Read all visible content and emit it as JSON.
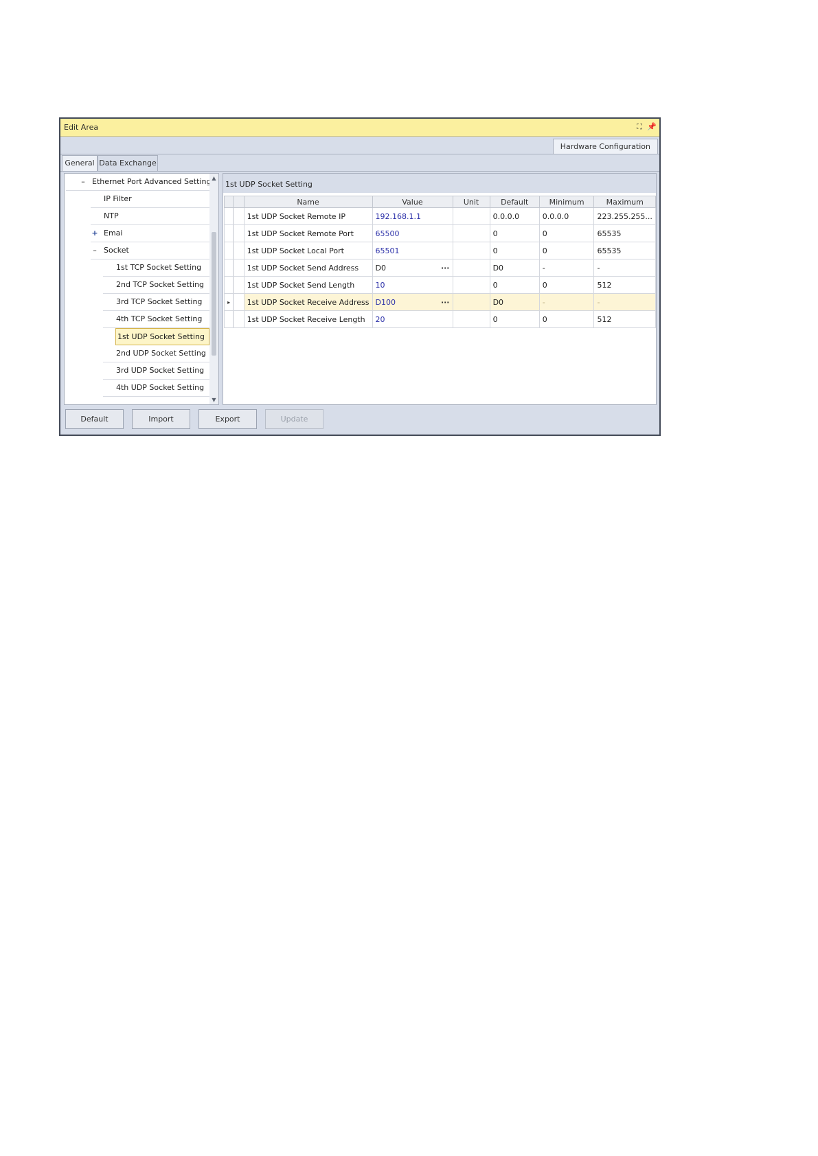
{
  "window": {
    "title": "Edit Area",
    "restore_glyph": "⛶",
    "pin_glyph": "📌",
    "doc_tab": "Hardware Configuration"
  },
  "tabs": [
    "General",
    "Data Exchange"
  ],
  "tree": {
    "items": [
      {
        "label": "Ethernet Port Advanced Setting",
        "expander": "–"
      },
      {
        "label": "IP Filter",
        "expander": ""
      },
      {
        "label": "NTP",
        "expander": ""
      },
      {
        "label": "Emai",
        "expander": "+"
      },
      {
        "label": "Socket",
        "expander": "–"
      },
      {
        "label": "1st TCP Socket Setting",
        "expander": ""
      },
      {
        "label": "2nd TCP Socket Setting",
        "expander": ""
      },
      {
        "label": "3rd TCP Socket Setting",
        "expander": ""
      },
      {
        "label": "4th TCP Socket Setting",
        "expander": ""
      },
      {
        "label": "1st UDP Socket Setting",
        "expander": ""
      },
      {
        "label": "2nd UDP Socket Setting",
        "expander": ""
      },
      {
        "label": "3rd UDP Socket Setting",
        "expander": ""
      },
      {
        "label": "4th UDP Socket Setting",
        "expander": ""
      }
    ],
    "scroll_up": "▲",
    "scroll_down": "▼"
  },
  "panel": {
    "title": "1st UDP Socket Setting",
    "columns": [
      "Name",
      "Value",
      "Unit",
      "Default",
      "Minimum",
      "Maximum"
    ],
    "row_indicator": "▸",
    "ellipsis": "···",
    "rows": [
      {
        "name": "1st UDP Socket Remote IP",
        "value": "192.168.1.1",
        "unit": "",
        "default": "0.0.0.0",
        "minimum": "0.0.0.0",
        "maximum": "223.255.255..."
      },
      {
        "name": "1st UDP Socket Remote Port",
        "value": "65500",
        "unit": "",
        "default": "0",
        "minimum": "0",
        "maximum": "65535"
      },
      {
        "name": "1st UDP Socket Local Port",
        "value": "65501",
        "unit": "",
        "default": "0",
        "minimum": "0",
        "maximum": "65535"
      },
      {
        "name": "1st UDP Socket Send Address",
        "value": "D0",
        "unit": "",
        "default": "D0",
        "minimum": "-",
        "maximum": "-"
      },
      {
        "name": "1st UDP Socket Send Length",
        "value": "10",
        "unit": "",
        "default": "0",
        "minimum": "0",
        "maximum": "512"
      },
      {
        "name": "1st UDP Socket Receive Address",
        "value": "D100",
        "unit": "",
        "default": "D0",
        "minimum": "-",
        "maximum": "-"
      },
      {
        "name": "1st UDP Socket Receive Length",
        "value": "20",
        "unit": "",
        "default": "0",
        "minimum": "0",
        "maximum": "512"
      }
    ]
  },
  "buttons": {
    "default": "Default",
    "import": "Import",
    "export": "Export",
    "update": "Update"
  }
}
